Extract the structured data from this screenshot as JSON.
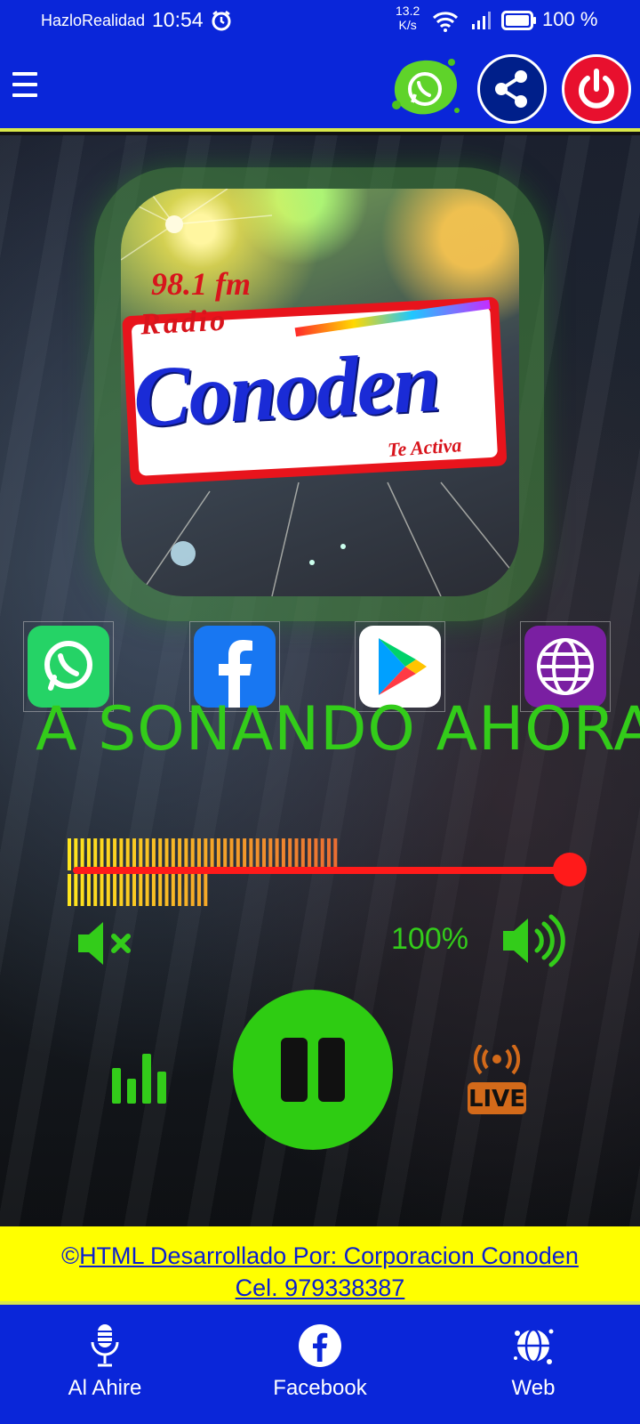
{
  "status_bar": {
    "carrier": "HazloRealidad",
    "time": "10:54",
    "net_speed_value": "13.2",
    "net_speed_unit": "K/s",
    "battery": "100 %",
    "battery_level": 1.0
  },
  "app_bar": {
    "icons": [
      "menu-icon",
      "whatsapp-icon",
      "share-icon",
      "power-icon"
    ]
  },
  "logo": {
    "frequency": "98.1 fm",
    "radio_word": "Radio",
    "name": "Conoden",
    "slogan": "Te Activa"
  },
  "social_links": [
    {
      "name": "whatsapp",
      "icon": "whatsapp-icon",
      "color": "#25d366"
    },
    {
      "name": "facebook",
      "icon": "facebook-icon",
      "color": "#1877f2"
    },
    {
      "name": "google-play",
      "icon": "google-play-icon",
      "color": "#ffffff"
    },
    {
      "name": "web",
      "icon": "globe-icon",
      "color": "#7a1fa2"
    }
  ],
  "ticker": {
    "text": "A  SONANDO AHORA",
    "color": "#33cc1a"
  },
  "player": {
    "volume_label": "100%",
    "volume_level": 1.0,
    "vu_level": 0.53,
    "state": "playing",
    "live_label": "LIVE"
  },
  "credit": {
    "copyright": "©",
    "line1": "HTML Desarrollado Por: Corporacion Conoden",
    "line2": "Cel. 979338387"
  },
  "bottom_nav": [
    {
      "label": "Al Ahire",
      "icon": "microphone-icon"
    },
    {
      "label": "Facebook",
      "icon": "facebook-icon"
    },
    {
      "label": "Web",
      "icon": "globe-icon"
    }
  ],
  "colors": {
    "primary": "#0a26d9",
    "accent_green": "#33cc1a",
    "volume_red": "#ff1a1a",
    "credit_bg": "#ffff00"
  }
}
